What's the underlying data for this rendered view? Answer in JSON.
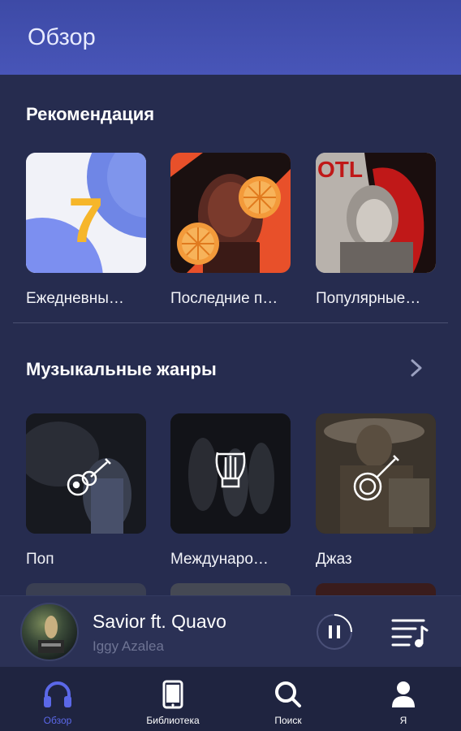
{
  "header": {
    "title": "Обзор"
  },
  "recommendations": {
    "title": "Рекомендация",
    "items": [
      {
        "label": "Ежедневны…",
        "badge": "7"
      },
      {
        "label": "Последние п…"
      },
      {
        "label": "Популярные…"
      }
    ]
  },
  "genres": {
    "title": "Музыкальные жанры",
    "items": [
      {
        "label": "Поп",
        "icon": "guitar-icon"
      },
      {
        "label": "Междунаро…",
        "icon": "lyre-icon"
      },
      {
        "label": "Джаз",
        "icon": "banjo-icon"
      }
    ]
  },
  "player": {
    "title": "Savior  ft. Quavo",
    "artist": "Iggy Azalea"
  },
  "tabs": [
    {
      "label": "Обзор",
      "icon": "headphones-icon",
      "active": true
    },
    {
      "label": "Библиотека",
      "icon": "phone-icon"
    },
    {
      "label": "Поиск",
      "icon": "search-icon"
    },
    {
      "label": "Я",
      "icon": "user-icon"
    }
  ],
  "colors": {
    "accent": "#5b68e8",
    "background": "#262c4f",
    "header": "#4451b0"
  }
}
